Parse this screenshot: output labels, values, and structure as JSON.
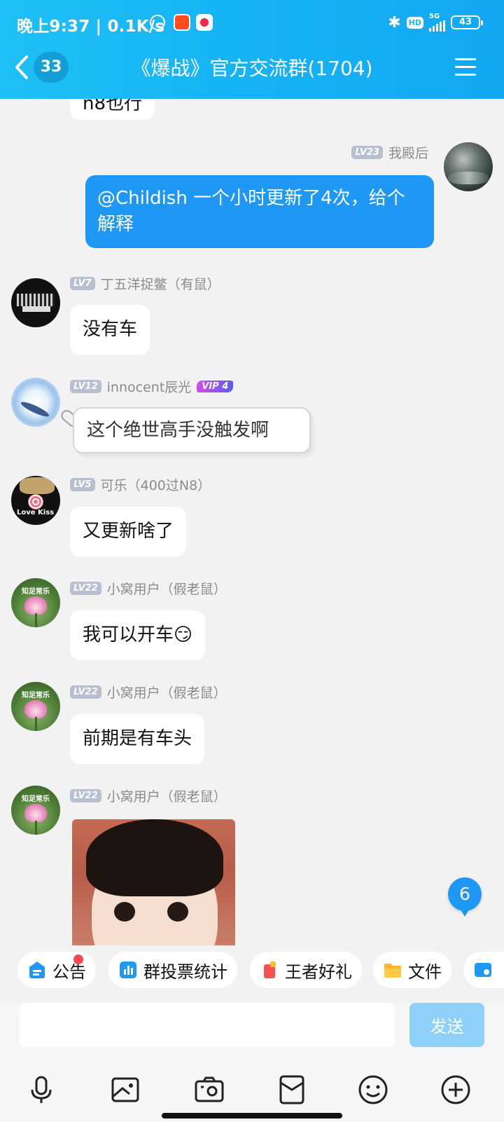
{
  "status_bar": {
    "time": "晚上9:37",
    "net_speed": "| 0.1K/s",
    "network": "5G",
    "hd": "HD",
    "battery": "43"
  },
  "header": {
    "back_count": "33",
    "title": "《爆战》官方交流群(1704)"
  },
  "messages": [
    {
      "sender": "",
      "level": "",
      "text": "n8也行",
      "outgoing": false,
      "partial": true
    },
    {
      "sender": "我殿后",
      "level": "LV23",
      "text": "@Childish 一个小时更新了4次，给个解释",
      "outgoing": true
    },
    {
      "sender": "丁五洋捉鳖（有鼠）",
      "level": "LV7",
      "text": "没有车"
    },
    {
      "sender": "innocent辰光",
      "level": "LV12",
      "vip": "VIP 4",
      "text": "这个绝世高手没触发啊"
    },
    {
      "sender": "可乐（400过N8）",
      "level": "LV5",
      "text": "又更新啥了",
      "avatar_text": "Love Kiss"
    },
    {
      "sender": "小窝用户（假老鼠）",
      "level": "LV22",
      "text": "我可以开车😏",
      "avatar_text": "知足常乐"
    },
    {
      "sender": "小窝用户（假老鼠）",
      "level": "LV22",
      "text": "前期是有车头",
      "avatar_text": "知足常乐"
    },
    {
      "sender": "小窝用户（假老鼠）",
      "level": "LV22",
      "image": "sticker-photo",
      "avatar_text": "知足常乐"
    }
  ],
  "new_message_count": "6",
  "quick_bar": [
    {
      "label": "公告",
      "icon": "announcement-icon",
      "has_dot": true
    },
    {
      "label": "群投票统计",
      "icon": "chart-icon"
    },
    {
      "label": "王者好礼",
      "icon": "gift-icon"
    },
    {
      "label": "文件",
      "icon": "folder-icon"
    }
  ],
  "input": {
    "value": "",
    "placeholder": "",
    "send_label": "发送"
  },
  "toolbar": [
    "voice-icon",
    "image-icon",
    "camera-icon",
    "red-packet-icon",
    "emoji-icon",
    "plus-icon"
  ],
  "colors": {
    "header": "#15b1f4",
    "bubble_outgoing": "#1e98f4",
    "send_disabled": "#8fd0f8",
    "level_badge": "#b7bfd0"
  }
}
